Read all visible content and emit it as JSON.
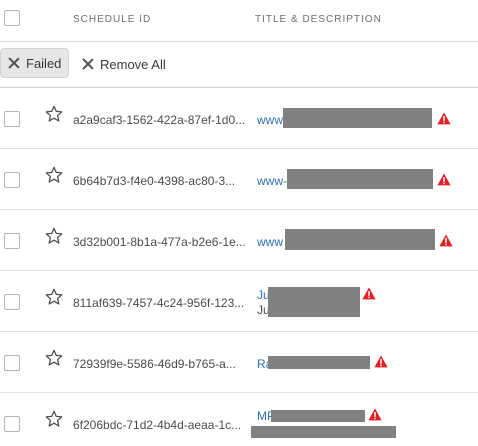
{
  "header": {
    "id_label": "SCHEDULE ID",
    "title_label": "TITLE & DESCRIPTION"
  },
  "filters": {
    "chip_label": "Failed",
    "remove_all_label": "Remove All"
  },
  "rows": [
    {
      "id": "a2a9caf3-1562-422a-87ef-1d0...",
      "title": "www",
      "status": "warning"
    },
    {
      "id": "6b64b7d3-f4e0-4398-ac80-3...",
      "title": "www-",
      "status": "warning"
    },
    {
      "id": "3d32b001-8b1a-477a-b2e6-1e...",
      "title": "www",
      "status": "warning"
    },
    {
      "id": "811af639-7457-4c24-956f-123...",
      "title": "Ju",
      "subtitle": "Ju",
      "status": "warning"
    },
    {
      "id": "72939f9e-5586-46d9-b765-a...",
      "title": "Ra",
      "status": "warning"
    },
    {
      "id": "6f206bdc-71d2-4b4d-aeaa-1c...",
      "title": "MP",
      "status": "warning"
    }
  ],
  "colors": {
    "link": "#2d6fb5",
    "warning": "#e31e24",
    "redaction": "#808080"
  }
}
